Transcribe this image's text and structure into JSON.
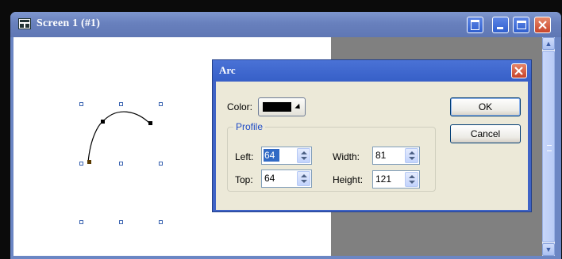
{
  "window": {
    "title": "Screen 1 (#1)"
  },
  "dialog": {
    "title": "Arc",
    "color_label": "Color:",
    "color_value": "#000000",
    "profile_label": "Profile",
    "left_label": "Left:",
    "left_value": "64",
    "top_label": "Top:",
    "top_value": "64",
    "width_label": "Width:",
    "width_value": "81",
    "height_label": "Height:",
    "height_value": "121",
    "ok_label": "OK",
    "cancel_label": "Cancel"
  },
  "icons": [
    "app-icon",
    "help-icon",
    "minimize-icon",
    "maximize-icon",
    "close-icon",
    "scroll-up-icon",
    "scroll-down-icon",
    "spin-up-icon",
    "spin-down-icon",
    "dropdown-arrow-icon"
  ],
  "colors": {
    "title_blue": "#6b86c4",
    "dialog_face": "#ece9d8",
    "workspace_gray": "#808080",
    "close_red": "#c8452a"
  }
}
